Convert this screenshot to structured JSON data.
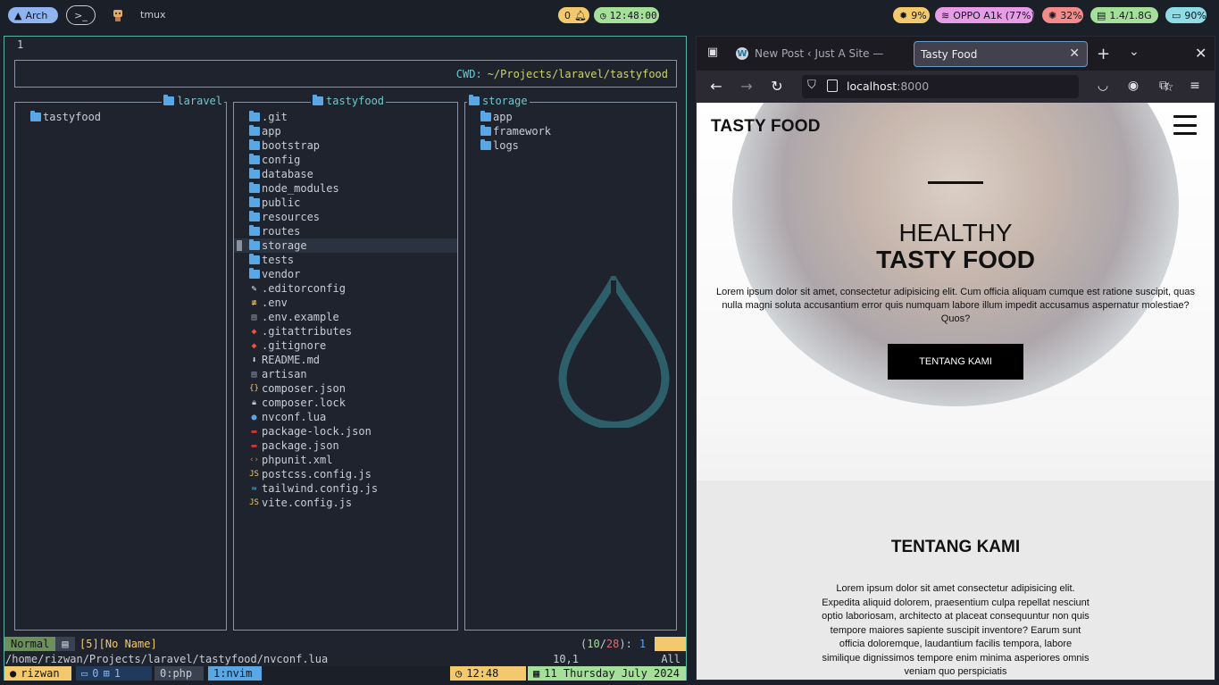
{
  "topbar": {
    "arch_label": "Arch",
    "tmux_label": "tmux",
    "notif_count": "0",
    "clock": "12:48:00",
    "cpu": "9%",
    "wifi": "OPPO A1k (77%)",
    "temp": "32%",
    "mem": "1.4/1.8G",
    "battery": "90%",
    "colors": {
      "yellow": "#f2c96d",
      "green": "#a6df9a",
      "pink": "#e69de6",
      "red": "#f28b8b",
      "cyan": "#8fdbe6",
      "blue": "#8fb4f0"
    }
  },
  "nvim": {
    "line_number": "1",
    "cwd_label": "CWD:",
    "cwd_path": "~/Projects/laravel/tastyfood",
    "parent_pane": {
      "title": "laravel",
      "entries": [
        {
          "name": "tastyfood",
          "icon": "folder-icon"
        }
      ]
    },
    "current_pane": {
      "title": "tastyfood",
      "entries": [
        {
          "name": ".git",
          "icon": "folder-icon"
        },
        {
          "name": "app",
          "icon": "folder-icon"
        },
        {
          "name": "bootstrap",
          "icon": "folder-icon"
        },
        {
          "name": "config",
          "icon": "folder-icon"
        },
        {
          "name": "database",
          "icon": "folder-icon"
        },
        {
          "name": "node_modules",
          "icon": "folder-icon"
        },
        {
          "name": "public",
          "icon": "folder-icon"
        },
        {
          "name": "resources",
          "icon": "folder-icon"
        },
        {
          "name": "routes",
          "icon": "folder-icon"
        },
        {
          "name": "storage",
          "icon": "folder-icon",
          "selected": true
        },
        {
          "name": "tests",
          "icon": "folder-icon"
        },
        {
          "name": "vendor",
          "icon": "folder-icon"
        },
        {
          "name": ".editorconfig",
          "icon": "editorconfig-icon"
        },
        {
          "name": ".env",
          "icon": "env-icon"
        },
        {
          "name": ".env.example",
          "icon": "file-icon"
        },
        {
          "name": ".gitattributes",
          "icon": "git-icon"
        },
        {
          "name": ".gitignore",
          "icon": "git-icon"
        },
        {
          "name": "README.md",
          "icon": "markdown-icon"
        },
        {
          "name": "artisan",
          "icon": "file-icon"
        },
        {
          "name": "composer.json",
          "icon": "json-icon"
        },
        {
          "name": "composer.lock",
          "icon": "lock-icon"
        },
        {
          "name": "nvconf.lua",
          "icon": "lua-icon"
        },
        {
          "name": "package-lock.json",
          "icon": "npm-icon"
        },
        {
          "name": "package.json",
          "icon": "npm-icon"
        },
        {
          "name": "phpunit.xml",
          "icon": "xml-icon"
        },
        {
          "name": "postcss.config.js",
          "icon": "js-icon"
        },
        {
          "name": "tailwind.config.js",
          "icon": "tailwind-icon"
        },
        {
          "name": "vite.config.js",
          "icon": "js-icon"
        }
      ]
    },
    "preview_pane": {
      "title": "storage",
      "entries": [
        {
          "name": "app",
          "icon": "folder-icon"
        },
        {
          "name": "framework",
          "icon": "folder-icon"
        },
        {
          "name": "logs",
          "icon": "folder-icon"
        }
      ]
    },
    "statusline": {
      "mode": "Normal",
      "buffer": "[5][No Name]",
      "count_open": "(",
      "count_cur": "10",
      "count_sep": "/",
      "count_total": "28",
      "count_close": "):",
      "count_extra": "1"
    },
    "cmdline": {
      "path": "/home/rizwan/Projects/laravel/tastyfood/nvconf.lua",
      "cursor": "10,1",
      "scroll": "All"
    }
  },
  "tmux": {
    "user": "rizwan",
    "session": "0",
    "pane_count": "1",
    "win0": "0:php",
    "win1": "1:nvim",
    "time": "12:48",
    "date": "11 Thursday July 2024"
  },
  "browser": {
    "tab1_title": "New Post ‹ Just A Site — W",
    "tab2_title": "Tasty Food",
    "url_host": "localhost",
    "url_port": ":8000",
    "page": {
      "logo": "TASTY FOOD",
      "hero_line1": "HEALTHY",
      "hero_line2": "TASTY FOOD",
      "hero_desc": "Lorem ipsum dolor sit amet, consectetur adipisicing elit. Cum officia aliquam cumque est ratione suscipit, quas nulla magni soluta accusantium error quis numquam labore illum impedit accusamus aspernatur molestiae? Quos?",
      "hero_button": "TENTANG KAMI",
      "about_title": "TENTANG KAMI",
      "about_text": "Lorem ipsum dolor sit amet consectetur adipisicing elit. Expedita aliquid dolorem, praesentium culpa repellat nesciunt optio laboriosam, architecto at placeat consequuntur non quis tempore maiores sapiente suscipit inventore? Earum sunt officia doloremque, laudantium facilis tempora, labore similique dignissimos tempore enim minima asperiores omnis veniam quo perspiciatis"
    }
  }
}
